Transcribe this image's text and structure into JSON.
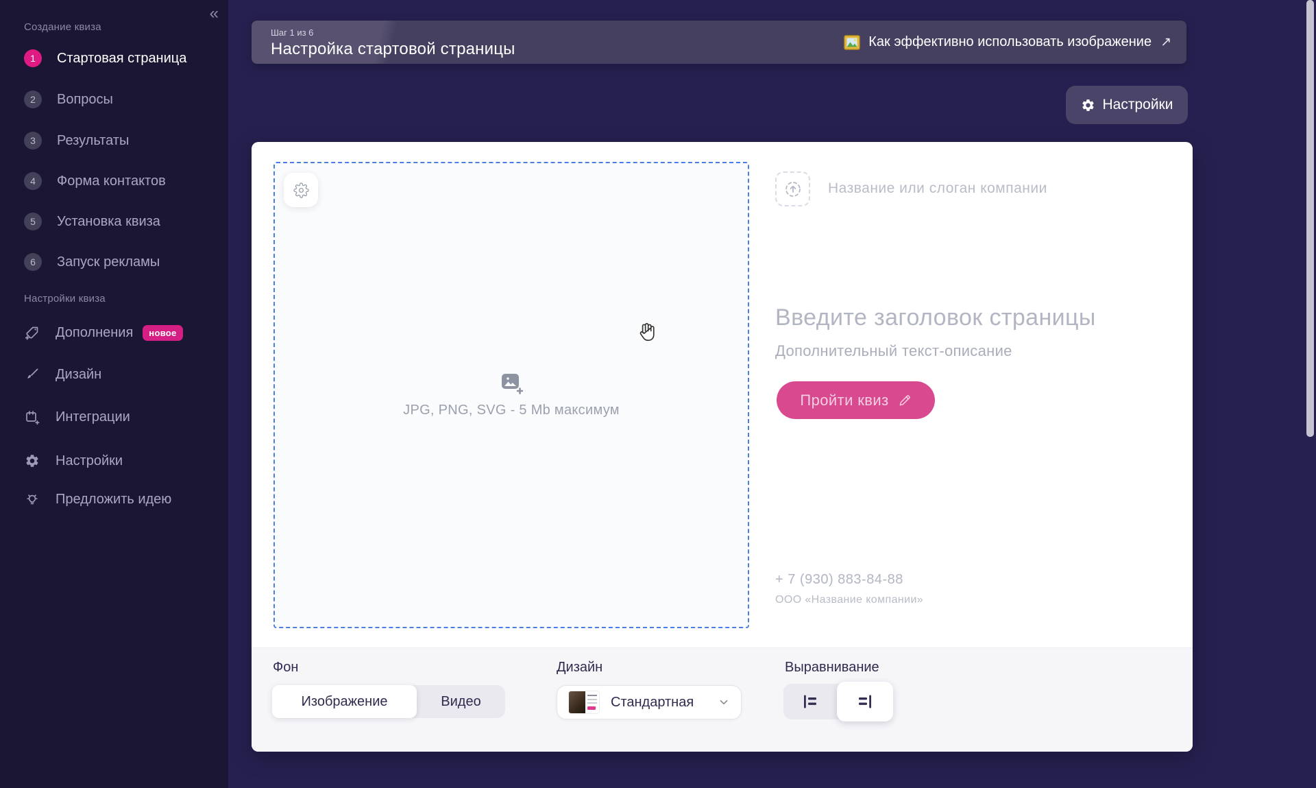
{
  "sidebar": {
    "collapse_icon": "«",
    "create_section": {
      "title": "Создание квиза",
      "items": [
        {
          "num": "1",
          "label": "Стартовая страница",
          "active": true
        },
        {
          "num": "2",
          "label": "Вопросы",
          "active": false
        },
        {
          "num": "3",
          "label": "Результаты",
          "active": false
        },
        {
          "num": "4",
          "label": "Форма контактов",
          "active": false
        },
        {
          "num": "5",
          "label": "Установка квиза",
          "active": false
        },
        {
          "num": "6",
          "label": "Запуск рекламы",
          "active": false
        }
      ]
    },
    "settings_section": {
      "title": "Настройки квиза",
      "items": [
        {
          "icon": "tag-plus-icon",
          "label": "Дополнения",
          "badge": "новое"
        },
        {
          "icon": "brush-icon",
          "label": "Дизайн"
        },
        {
          "icon": "integrations-icon",
          "label": "Интеграции"
        },
        {
          "icon": "gear-icon",
          "label": "Настройки"
        },
        {
          "icon": "lightbulb-icon",
          "label": "Предложить идею"
        }
      ]
    }
  },
  "header": {
    "step": "Шаг 1 из 6",
    "title": "Настройка стартовой страницы",
    "help": {
      "icon": "framed-picture-emoji",
      "label": "Как эффективно использовать изображение",
      "arrow": "↗"
    },
    "settings_button": "Настройки"
  },
  "editor": {
    "upload_hint": "JPG, PNG, SVG - 5 Mb максимум",
    "preview": {
      "logo_placeholder": "Название или слоган компании",
      "title_placeholder": "Введите заголовок страницы",
      "description_placeholder": "Дополнительный текст-описание",
      "cta_label": "Пройти квиз",
      "phone": "+ 7 (930) 883-84-88",
      "company": "ООО «Название компании»"
    }
  },
  "footer_controls": {
    "background": {
      "label": "Фон",
      "options": [
        {
          "label": "Изображение",
          "selected": true
        },
        {
          "label": "Видео",
          "selected": false
        }
      ]
    },
    "design": {
      "label": "Дизайн",
      "value": "Стандартная"
    },
    "alignment": {
      "label": "Выравнивание",
      "selected": "right"
    }
  },
  "colors": {
    "accent_pink": "#e01a83",
    "cta_pink": "#d8498f",
    "upload_border_blue": "#4a7de2",
    "sidebar_bg": "#1b1634",
    "page_bg": "#262050"
  }
}
